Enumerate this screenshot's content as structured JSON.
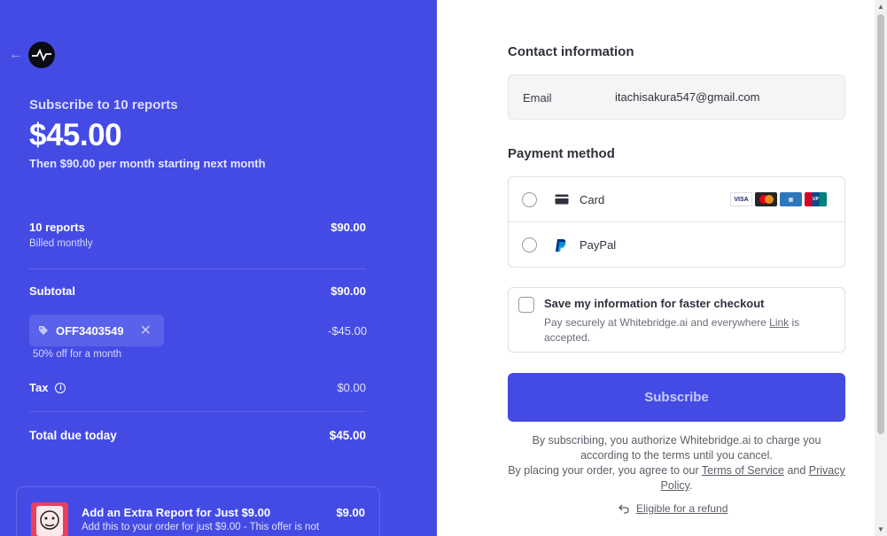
{
  "summary": {
    "subscribe_title": "Subscribe to 10 reports",
    "price": "$45.00",
    "then_text": "Then $90.00 per month starting next month",
    "line_item": {
      "name": "10 reports",
      "billing": "Billed monthly",
      "amount": "$90.00"
    },
    "subtotal": {
      "label": "Subtotal",
      "amount": "$90.00"
    },
    "promo": {
      "code": "OFF3403549",
      "note": "50% off for a month",
      "discount": "-$45.00"
    },
    "tax": {
      "label": "Tax",
      "amount": "$0.00"
    },
    "total": {
      "label": "Total due today",
      "amount": "$45.00"
    },
    "upsell": {
      "title": "Add an Extra Report for Just $9.00",
      "price": "$9.00",
      "description": "Add this to your order for just $9.00 - This offer is not"
    }
  },
  "contact": {
    "heading": "Contact information",
    "email_label": "Email",
    "email_value": "itachisakura547@gmail.com"
  },
  "payment": {
    "heading": "Payment method",
    "options": [
      {
        "label": "Card",
        "icon": "card-icon"
      },
      {
        "label": "PayPal",
        "icon": "paypal-icon"
      }
    ],
    "card_brands": [
      "VISA",
      "MC",
      "AMEX",
      "UnionPay"
    ]
  },
  "save_info": {
    "title": "Save my information for faster checkout",
    "desc_prefix": "Pay securely at Whitebridge.ai and everywhere ",
    "desc_link": "Link",
    "desc_suffix": " is accepted."
  },
  "subscribe_button": "Subscribe",
  "legal": {
    "line1": "By subscribing, you authorize Whitebridge.ai to charge you according to the terms until you cancel.",
    "line2_prefix": "By placing your order, you agree to our ",
    "terms_link": "Terms of Service",
    "and": " and ",
    "privacy_link": "Privacy Policy",
    "period": "."
  },
  "refund_link": "Eligible for a refund",
  "colors": {
    "brand": "#444be5",
    "text": "#30313d"
  }
}
